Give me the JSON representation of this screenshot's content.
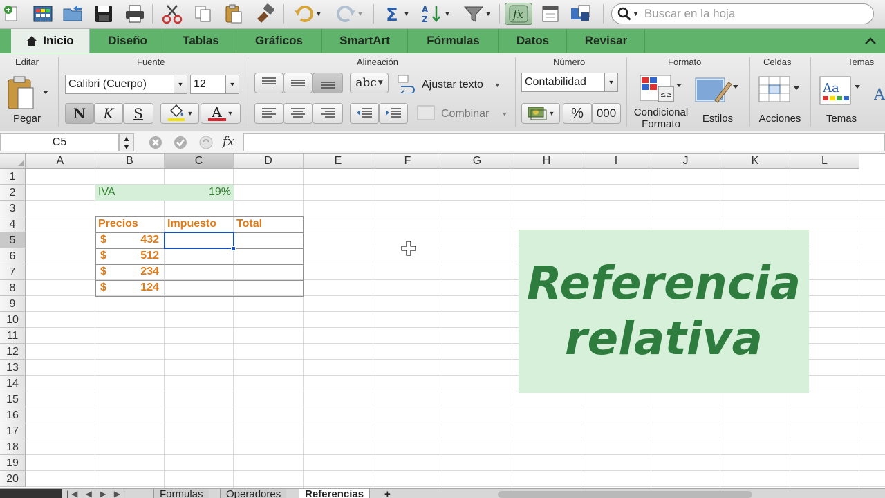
{
  "toolbar": {
    "search_placeholder": "Buscar en la hoja",
    "icons": [
      "new-icon",
      "gallery-icon",
      "open-icon",
      "save-icon",
      "print-icon",
      "cut-icon",
      "copy-icon",
      "paste-icon",
      "format-painter-icon",
      "undo-icon",
      "redo-icon",
      "autosum-icon",
      "sort-icon",
      "filter-icon",
      "function-icon",
      "toolbox-icon",
      "media-icon",
      "search-icon"
    ]
  },
  "tabs": [
    "Inicio",
    "Diseño",
    "Tablas",
    "Gráficos",
    "SmartArt",
    "Fórmulas",
    "Datos",
    "Revisar"
  ],
  "ribbon": {
    "groups": {
      "editar": "Editar",
      "fuente": "Fuente",
      "alineacion": "Alineación",
      "numero": "Número",
      "formato": "Formato",
      "celdas": "Celdas",
      "temas": "Temas"
    },
    "paste_label": "Pegar",
    "font_name": "Calibri (Cuerpo)",
    "font_size": "12",
    "bold": "N",
    "italic": "K",
    "underline": "S",
    "font_color_glyph": "A",
    "wrap_text": "Ajustar texto",
    "merge": "Combinar",
    "orientation": "abc",
    "number_format": "Contabilidad",
    "percent": "%",
    "thousands": "000",
    "conditional_format": "Condicional\nFormato",
    "conditional_format_line1": "Condicional",
    "conditional_format_line2": "Formato",
    "styles": "Estilos",
    "actions": "Acciones",
    "themes": "Temas",
    "themes_sample": "Aa"
  },
  "formula_bar": {
    "cell_ref": "C5",
    "fx": "fx",
    "value": ""
  },
  "grid": {
    "columns": [
      "A",
      "B",
      "C",
      "D",
      "E",
      "F",
      "G",
      "H",
      "I",
      "J",
      "K",
      "L"
    ],
    "rows": [
      "1",
      "2",
      "3",
      "4",
      "5",
      "6",
      "7",
      "8",
      "9",
      "10",
      "11",
      "12",
      "13",
      "14",
      "15",
      "16",
      "17",
      "18",
      "19",
      "20"
    ],
    "selected_cell": "C5",
    "iva_label": "IVA",
    "iva_value": "19%",
    "headers": {
      "precios": "Precios",
      "impuesto": "Impuesto",
      "total": "Total"
    },
    "currency_symbol": "$",
    "prices": [
      "432",
      "512",
      "234",
      "124"
    ]
  },
  "overlay": {
    "line1": "Referencia",
    "line2": "relativa"
  },
  "sheets": [
    "Formulas",
    "Operadores",
    "Referencias",
    "+"
  ],
  "colors": {
    "ribbon_green": "#5fb36b",
    "header_orange": "#e07b1a",
    "iva_fill": "#d5efd9",
    "overlay_bg": "#d6f0d9",
    "overlay_text": "#2e7d3e",
    "selection": "#1c4fb8"
  }
}
